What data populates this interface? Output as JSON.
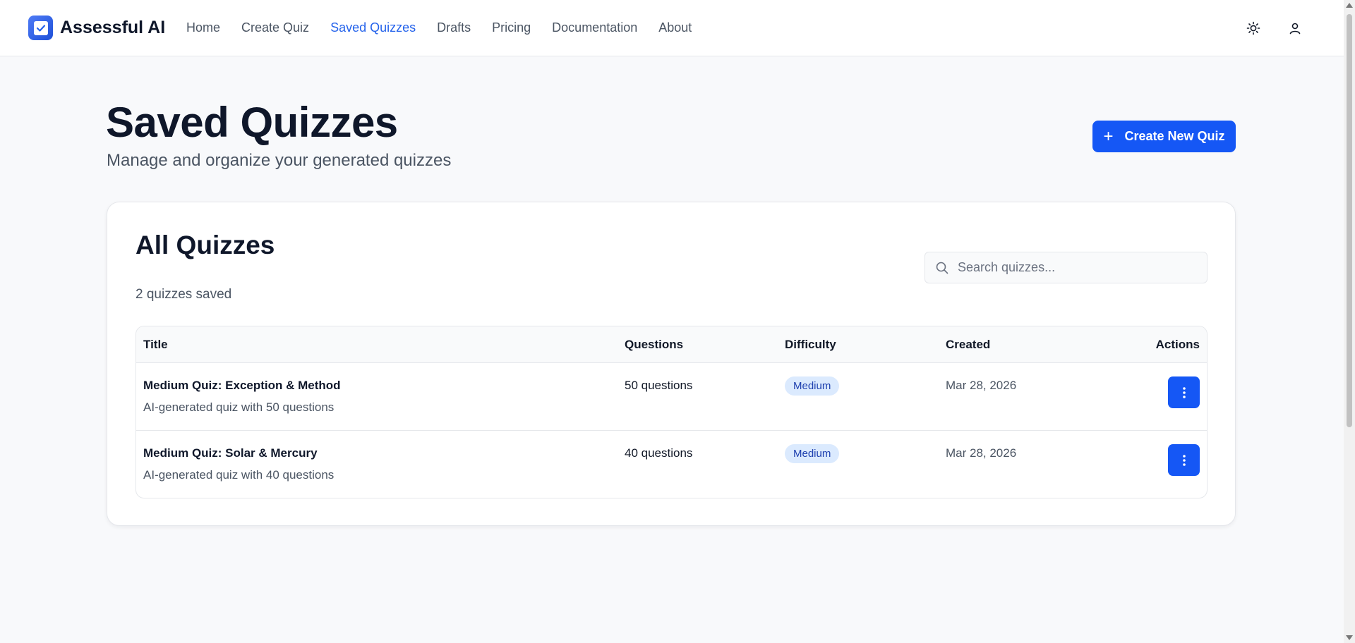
{
  "app": {
    "name": "Assessful AI",
    "brand_color": "#1557f5",
    "icons": {
      "logo": "checkbox-icon",
      "theme": "sun-icon",
      "profile": "user-icon"
    }
  },
  "nav": {
    "items": [
      {
        "label": "Home",
        "active": false
      },
      {
        "label": "Create Quiz",
        "active": false
      },
      {
        "label": "Saved Quizzes",
        "active": true
      },
      {
        "label": "Drafts",
        "active": false
      },
      {
        "label": "Pricing",
        "active": false
      },
      {
        "label": "Documentation",
        "active": false
      },
      {
        "label": "About",
        "active": false
      }
    ]
  },
  "page": {
    "title": "Saved Quizzes",
    "subtitle": "Manage and organize your generated quizzes",
    "create_button": {
      "icon": "plus-icon",
      "label": "Create New Quiz"
    }
  },
  "card": {
    "title": "All Quizzes",
    "count_text": "2 quizzes saved",
    "search": {
      "placeholder": "Search quizzes...",
      "value": "",
      "icon": "search-icon"
    }
  },
  "table": {
    "headers": [
      "Title",
      "Questions",
      "Difficulty",
      "Created",
      "Actions"
    ],
    "rows": [
      {
        "title": "Medium Quiz: Exception & Method",
        "description": "AI-generated quiz with 50 questions",
        "questions": "50 questions",
        "difficulty": "Medium",
        "created": "Mar 28, 2026",
        "action_icon": "more-vertical-icon"
      },
      {
        "title": "Medium Quiz: Solar & Mercury",
        "description": "AI-generated quiz with 40 questions",
        "questions": "40 questions",
        "difficulty": "Medium",
        "created": "Mar 28, 2026",
        "action_icon": "more-vertical-icon"
      }
    ]
  }
}
